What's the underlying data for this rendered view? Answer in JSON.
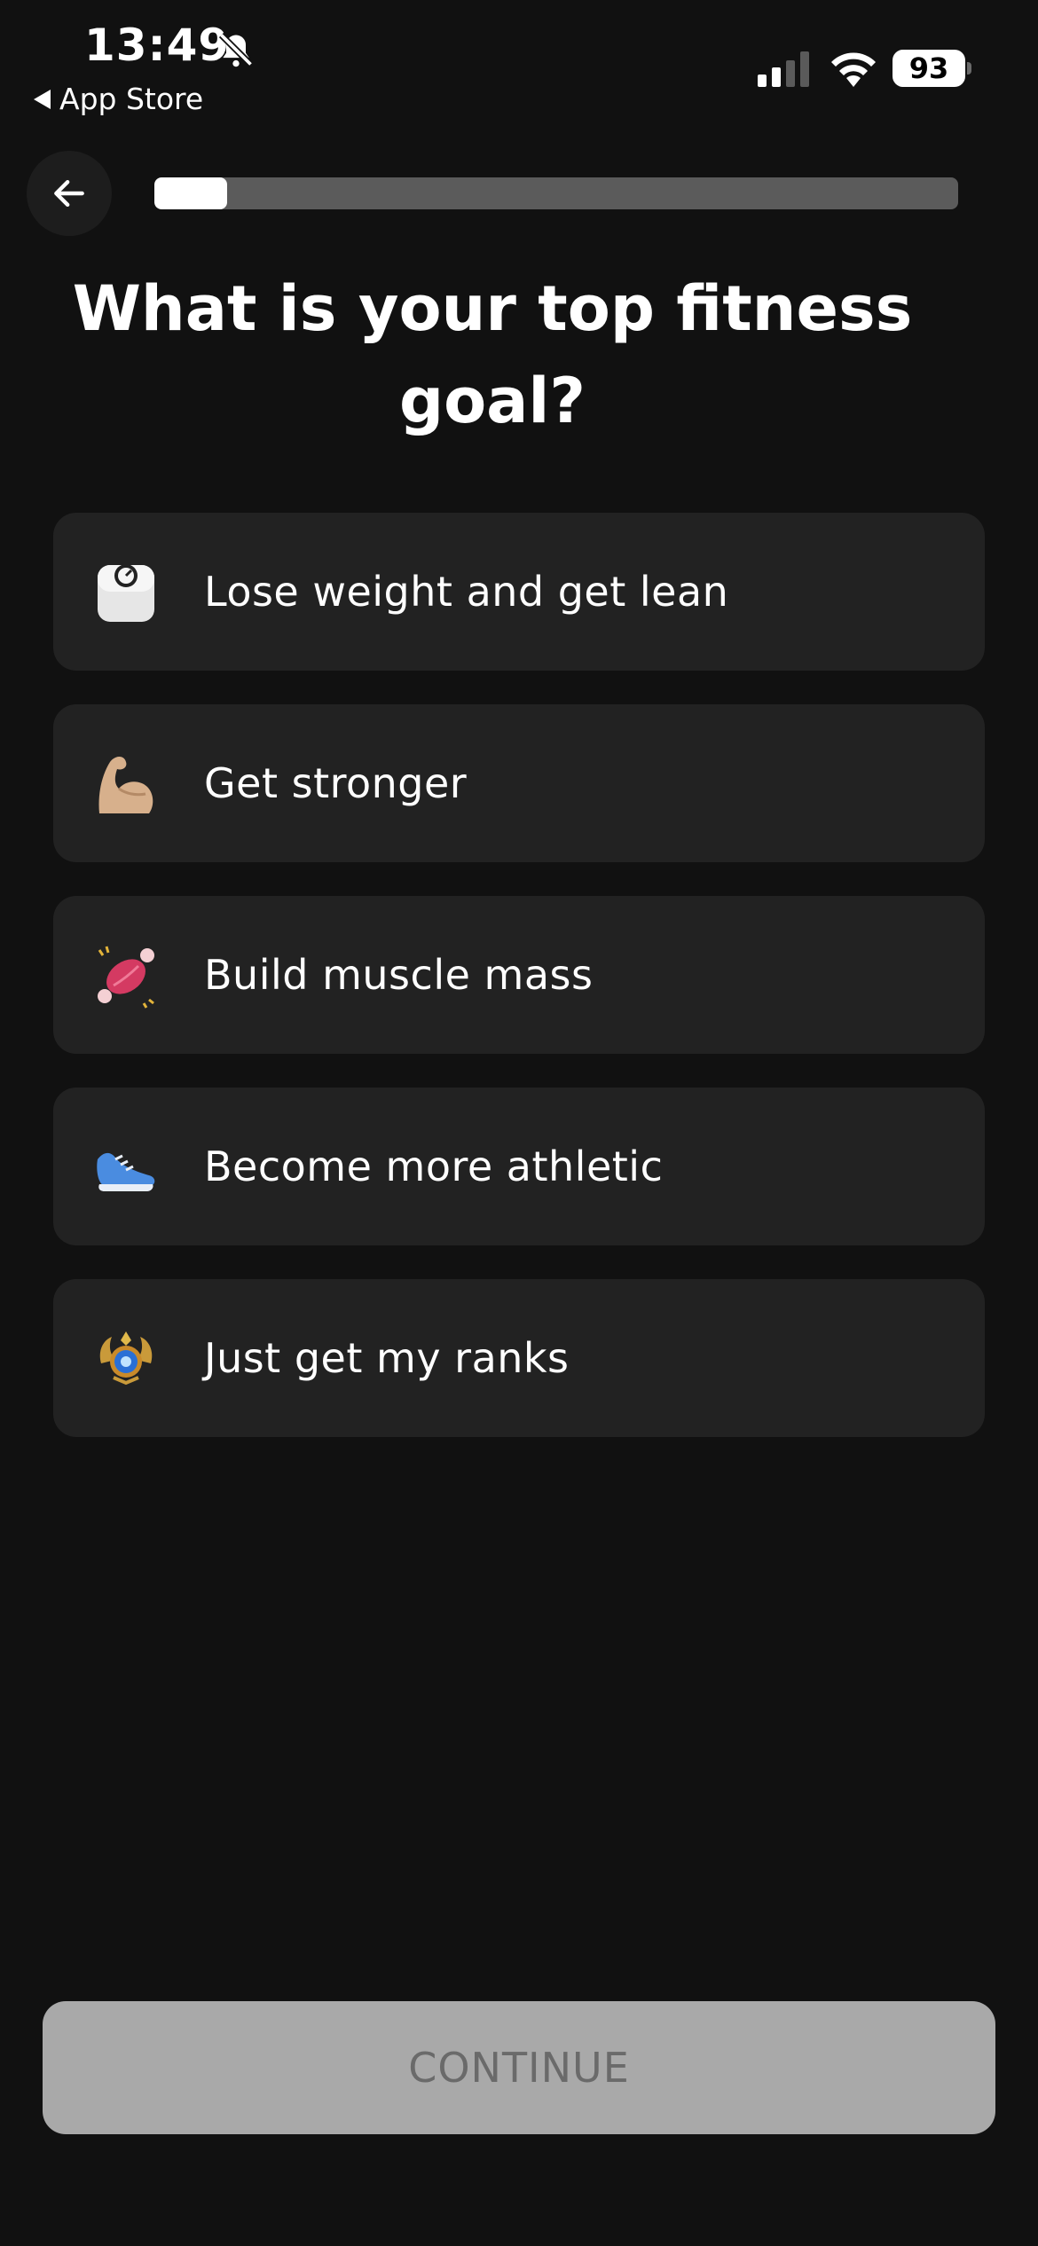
{
  "status_bar": {
    "time": "13:49",
    "back_app_label": "App Store",
    "battery": "93",
    "icons": [
      "bell-slash-icon",
      "signal-icon",
      "wifi-icon",
      "battery-icon"
    ]
  },
  "onboarding": {
    "progress_fraction": 0.09,
    "title": "What is your top fitness goal?"
  },
  "options": [
    {
      "icon": "scale-icon",
      "label": "Lose weight and get lean"
    },
    {
      "icon": "flexed-biceps-icon",
      "label": "Get stronger"
    },
    {
      "icon": "muscle-meat-icon",
      "label": "Build muscle mass"
    },
    {
      "icon": "sneaker-icon",
      "label": "Become more athletic"
    },
    {
      "icon": "rank-badge-icon",
      "label": "Just get my ranks"
    }
  ],
  "footer": {
    "continue_label": "CONTINUE"
  },
  "colors": {
    "background": "#111111",
    "card": "#222222",
    "button_disabled": "#a9a9a9"
  }
}
